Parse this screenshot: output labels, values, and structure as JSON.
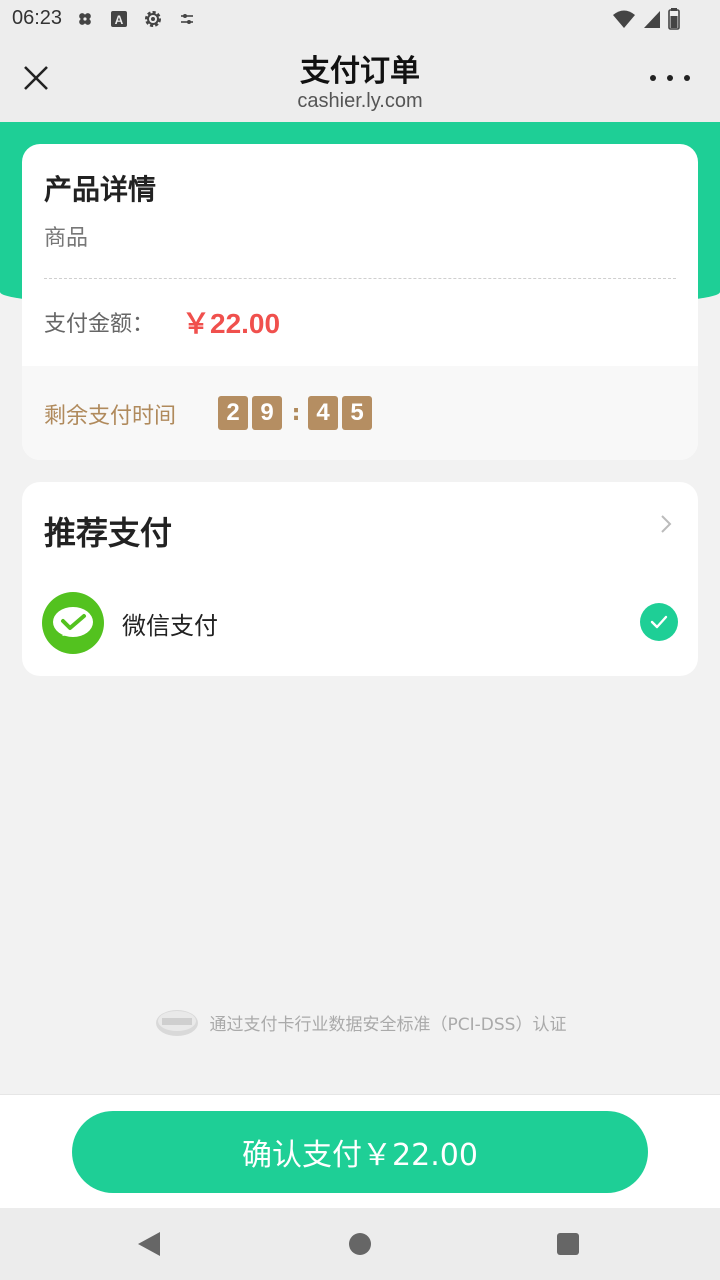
{
  "status_bar": {
    "time": "06:23",
    "icons": [
      "bandage-icon",
      "a-box-icon",
      "gear-icon",
      "sliders-icon"
    ],
    "right_icons": [
      "wifi-icon",
      "signal-icon",
      "battery-icon"
    ]
  },
  "header": {
    "title": "支付订单",
    "subtitle": "cashier.ly.com",
    "close_icon": "close-icon",
    "more_icon": "more-dots-icon"
  },
  "product": {
    "section_title": "产品详情",
    "name": "商品",
    "amount_label": "支付金额：",
    "amount_value": "￥22.00",
    "timer_label": "剩余支付时间",
    "timer_digits": [
      "2",
      "9",
      "4",
      "5"
    ],
    "timer_separator": ":"
  },
  "payment": {
    "section_title": "推荐支付",
    "methods": [
      {
        "label": "微信支付",
        "icon": "wechat-pay-icon",
        "selected": true
      }
    ]
  },
  "footer": {
    "pci_text": "通过支付卡行业数据安全标准（PCI-DSS）认证",
    "confirm_label": "确认支付￥22.00"
  },
  "colors": {
    "brand_green": "#1ecf96",
    "price_red": "#f0504d",
    "timer_brown": "#b58e62",
    "wechat_green": "#53c21f"
  }
}
